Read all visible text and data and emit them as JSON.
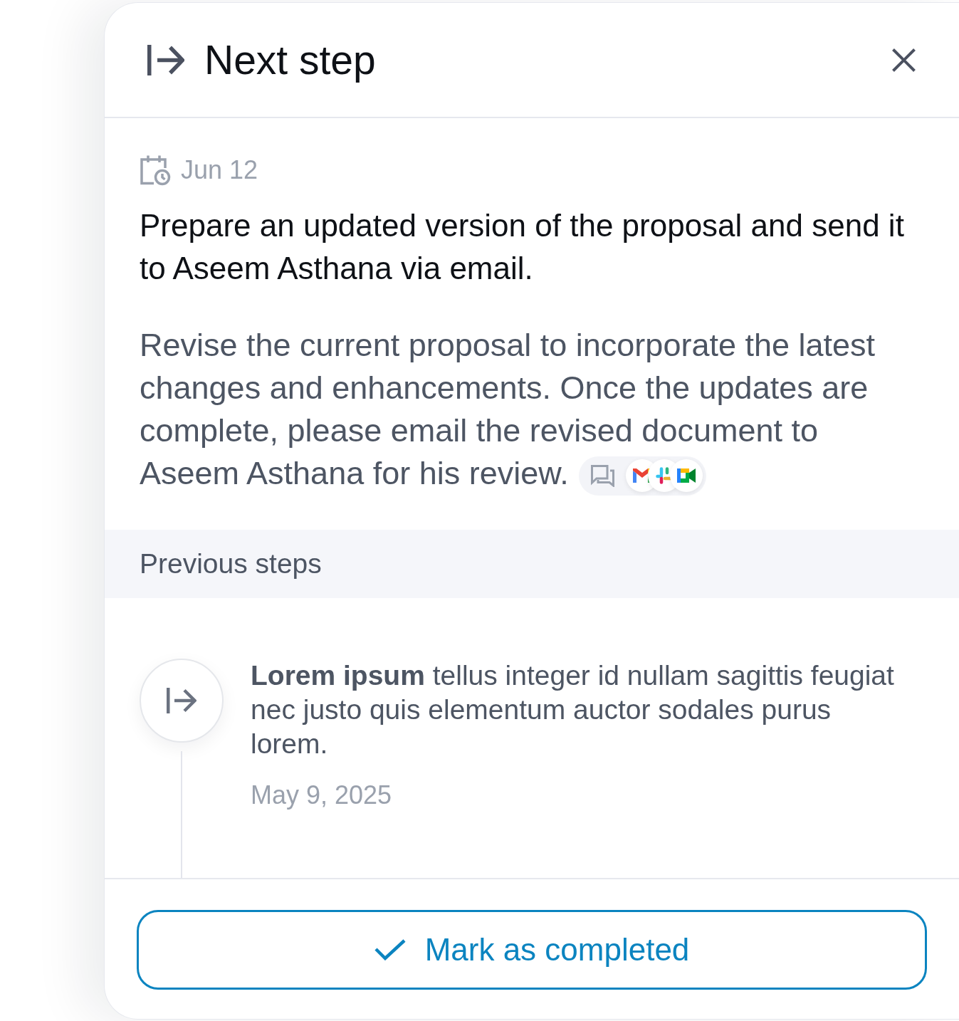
{
  "header": {
    "title": "Next step"
  },
  "next_step": {
    "date": "Jun 12",
    "title": "Prepare an updated version of the proposal and send it to Aseem Asthana via email.",
    "description": "Revise the current proposal to incorporate the latest changes and enhancements. Once the updates are complete, please email the revised document to Aseem Asthana for his review."
  },
  "previous_steps": {
    "heading": "Previous steps",
    "items": [
      {
        "text": "**Lorem ipsum** tellus integer id nullam sagittis feugiat nec justo quis elementum auctor sodales purus lorem.",
        "date": "May 9, 2025"
      }
    ]
  },
  "footer": {
    "button": "Mark as completed"
  }
}
